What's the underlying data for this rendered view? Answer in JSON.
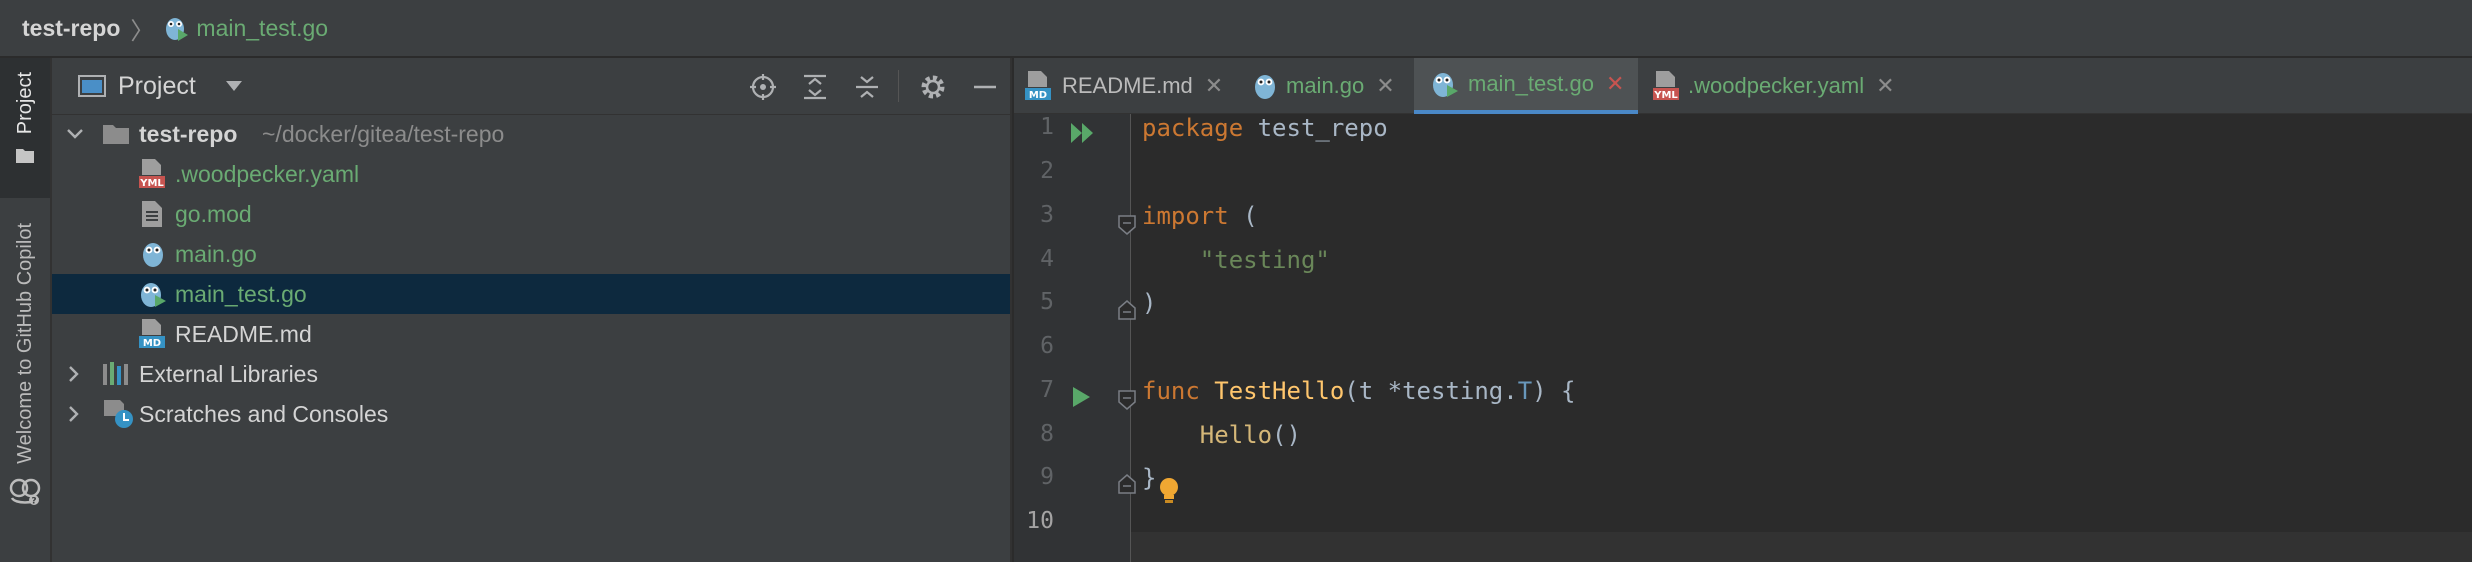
{
  "breadcrumb": {
    "root": "test-repo",
    "separator": "〉",
    "file": "main_test.go"
  },
  "sidebar_tabs": {
    "project": "Project",
    "copilot": "Welcome to GitHub Copilot"
  },
  "project_panel": {
    "title": "Project",
    "tree": {
      "root": {
        "name": "test-repo",
        "path": "~/docker/gitea/test-repo"
      },
      "files": [
        {
          "name": ".woodpecker.yaml",
          "icon": "yaml-file-icon",
          "badge": "YML"
        },
        {
          "name": "go.mod",
          "icon": "text-file-icon"
        },
        {
          "name": "main.go",
          "icon": "go-file-icon"
        },
        {
          "name": "main_test.go",
          "icon": "go-test-file-icon",
          "selected": true
        },
        {
          "name": "README.md",
          "icon": "markdown-file-icon",
          "badge": "MD"
        }
      ],
      "external_libraries": "External Libraries",
      "scratches": "Scratches and Consoles"
    }
  },
  "editor_tabs": [
    {
      "label": "README.md",
      "icon": "markdown-file-icon",
      "badge": "MD",
      "active": false
    },
    {
      "label": "main.go",
      "icon": "go-file-icon",
      "active": false
    },
    {
      "label": "main_test.go",
      "icon": "go-test-file-icon",
      "active": true
    },
    {
      "label": ".woodpecker.yaml",
      "icon": "yaml-file-icon",
      "badge": "YML",
      "active": false
    }
  ],
  "tab_close_glyph": "✕",
  "code": {
    "line_numbers": [
      "1",
      "2",
      "3",
      "4",
      "5",
      "6",
      "7",
      "8",
      "9",
      "10"
    ],
    "lines": {
      "l1_kw": "package",
      "l1_rest": " test_repo",
      "l3_kw": "import",
      "l3_rest": " (",
      "l4_str": "    \"testing\"",
      "l5": ")",
      "l7_kw": "func",
      "l7_fn": "TestHello",
      "l7_a": "(t *testing.",
      "l7_type": "T",
      "l7_b": ") {",
      "l8_call": "    Hello",
      "l8_rest": "()",
      "l9": "}"
    }
  },
  "colors": {
    "keyword": "#cc7832",
    "function": "#ffc66d",
    "string": "#6a8759",
    "vcs_added": "#6aab73",
    "selection": "#0d293e",
    "active_tab_underline": "#4a88c7"
  }
}
